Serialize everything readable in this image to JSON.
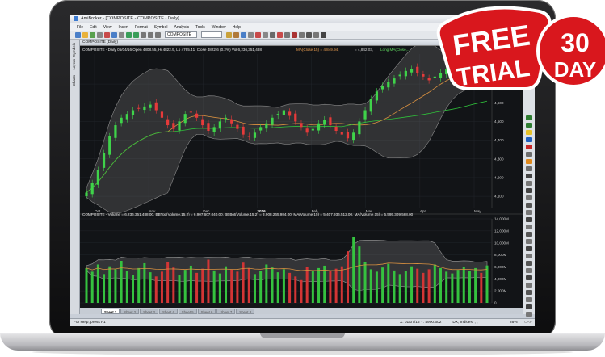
{
  "window": {
    "title": "AmiBroker - [COMPOSITE - COMPOSITE - Daily]",
    "menus": [
      "File",
      "Edit",
      "View",
      "Insert",
      "Format",
      "Symbol",
      "Analysis",
      "Tools",
      "Window",
      "Help"
    ],
    "symbol": "COMPOSITE"
  },
  "side_tabs": [
    "Symbols",
    "Layers",
    "Charts"
  ],
  "price_pane": {
    "title": "COMPOSITE (Daily)",
    "header": "COMPOSITE - Daily 05/04/16 Open 4808.55, Hi 4822.9, Lo 4765.41, Close 4822.6 (0.2%) Vol 6,236,351,488",
    "ma_header": "MA(Close,15) = 4,849.94,",
    "bb_header": "= 4,842.03,",
    "ma_long_header": "Long MA(Close,..."
  },
  "volume_pane": {
    "header": "COMPOSITE - Volume = 6,236,351,488.00, BBTop(Volume,15,2) = 6,907,607,040.00, BBBot(Volume,15,2) = 3,908,265,984.00, MA(Volume,15) = 5,407,936,512.00, MA(Volume,15) = 5,595,309,568.00"
  },
  "sheets": [
    "Sheet 1",
    "Sheet 2",
    "Sheet 3",
    "Sheet 4",
    "Sheet 5",
    "Sheet 6",
    "Sheet 7",
    "Sheet 8"
  ],
  "status": {
    "help": "For Help, press F1",
    "coords": "X: 01/07/16  Y: 4900.602",
    "market": "IDX, Indices, , ,",
    "zoom": "26%",
    "mode": "CAP"
  },
  "promo": {
    "free": "FREE",
    "trial": "TRIAL",
    "days": "30",
    "day_label": "DAY"
  },
  "chart_data": [
    {
      "type": "candlestick",
      "series": [
        {
          "name": "COMPOSITE"
        }
      ],
      "x_ticks": [
        "Oct",
        "Nov",
        "Dec",
        "2016",
        "Feb",
        "Mar",
        "Apr",
        "May"
      ],
      "y_ticks": [
        4100,
        4200,
        4300,
        4400,
        4500,
        4600,
        4700
      ],
      "ylim": [
        4040,
        4860
      ],
      "closes": [
        4120,
        4170,
        4240,
        4330,
        4420,
        4480,
        4520,
        4540,
        4560,
        4570,
        4580,
        4590,
        4560,
        4520,
        4480,
        4460,
        4500,
        4540,
        4550,
        4520,
        4480,
        4450,
        4470,
        4500,
        4520,
        4490,
        4460,
        4430,
        4420,
        4440,
        4470,
        4490,
        4520,
        4540,
        4560,
        4530,
        4500,
        4470,
        4440,
        4460,
        4490,
        4510,
        4480,
        4450,
        4430,
        4410,
        4440,
        4500,
        4560,
        4620,
        4660,
        4690,
        4710,
        4730,
        4750,
        4770,
        4780,
        4760,
        4740,
        4720,
        4740,
        4760,
        4780,
        4790,
        4800,
        4810,
        4820,
        4830,
        4815,
        4822
      ]
    },
    {
      "type": "bar",
      "series": [
        {
          "name": "Volume"
        }
      ],
      "y_ticks": [
        "0",
        "2,000M",
        "4,000M",
        "6,000M",
        "8,000M",
        "10,000M",
        "12,000M",
        "14,000M"
      ],
      "ylim": [
        0,
        14000
      ],
      "values": [
        5800,
        5200,
        6400,
        4800,
        6100,
        5600,
        7000,
        5300,
        4700,
        5800,
        6600,
        5100,
        4400,
        5200,
        6800,
        5900,
        4600,
        5500,
        6200,
        5000,
        5700,
        7200,
        5400,
        4900,
        6100,
        5600,
        5200,
        6700,
        5800,
        4800,
        5300,
        6400,
        5900,
        5100,
        5600,
        5000,
        4400,
        3800,
        6000,
        5400,
        5800,
        6200,
        5300,
        5700,
        6100,
        8600,
        11000,
        9400,
        6800,
        5600,
        5200,
        5900,
        6500,
        5400,
        4800,
        5300,
        6100,
        5700,
        5000,
        5600,
        6400,
        5800,
        5200,
        4900,
        5500,
        6000,
        5300,
        5800,
        5000,
        6236
      ]
    }
  ]
}
